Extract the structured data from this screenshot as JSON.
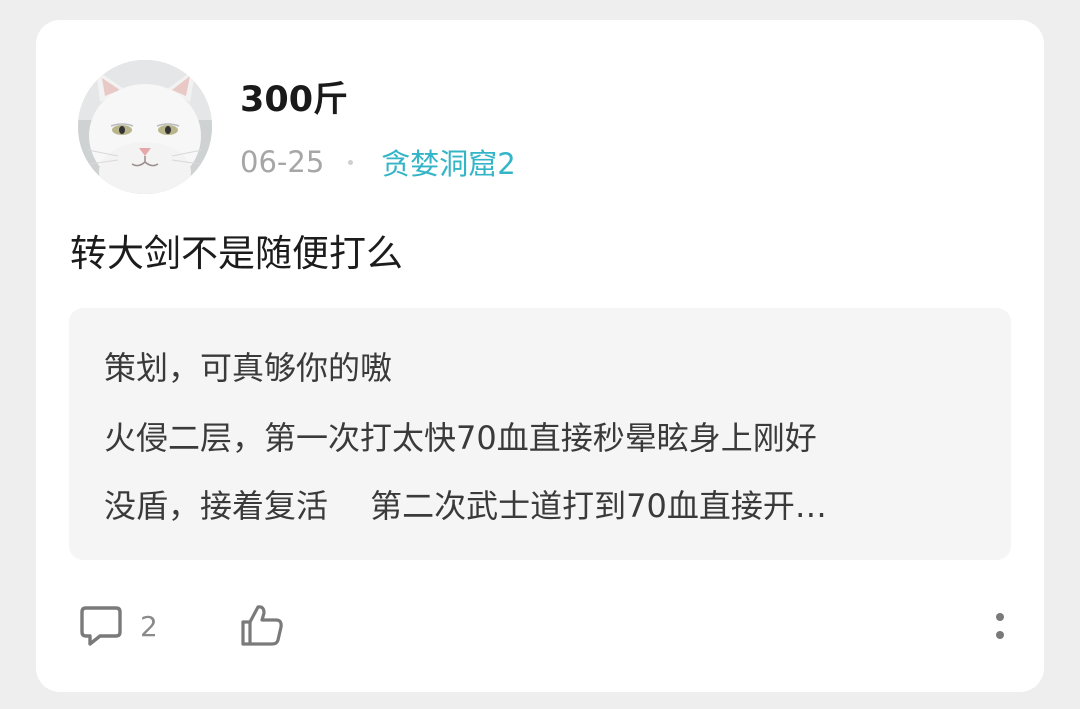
{
  "post": {
    "author": {
      "name": "300斤",
      "avatar": "white-cat-avatar"
    },
    "date": "06-25",
    "channel": "贪婪洞窟2",
    "title": "转大剑不是随便打么",
    "quote_lines": [
      "策划，可真够你的嗷",
      "火侵二层，第一次打太快70血直接秒晕眩身上刚好",
      "没盾，接着复活  第二次武士道打到70血直接开…"
    ],
    "comment_count": "2"
  },
  "icons": {
    "comment": "comment-icon",
    "like": "thumbs-up-icon",
    "more": "more-vertical-icon"
  },
  "colors": {
    "channel": "#34b5c7",
    "card_bg": "#ffffff",
    "page_bg": "#eeeeee",
    "quote_bg": "#f5f5f5"
  }
}
